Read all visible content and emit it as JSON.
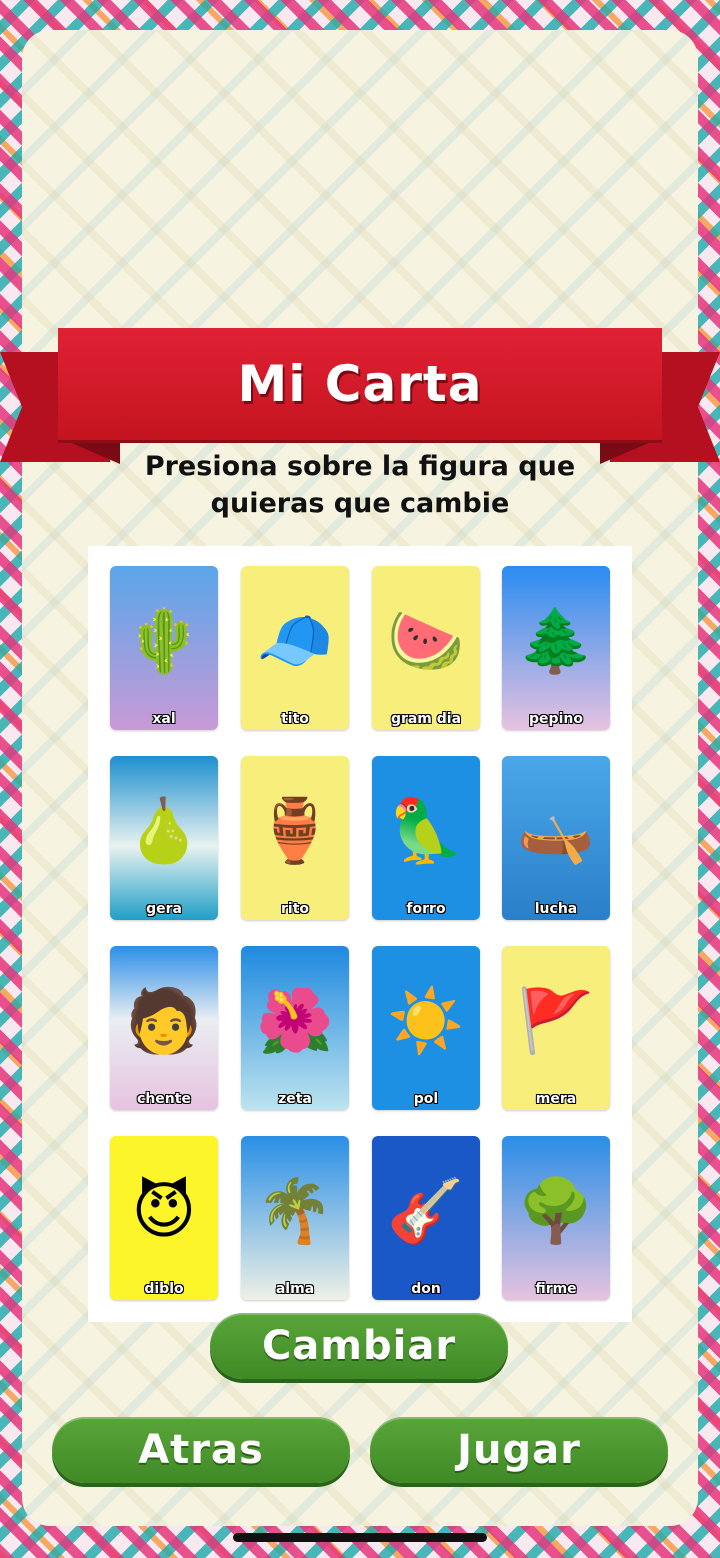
{
  "header": {
    "title": "Mi Carta"
  },
  "instructions": {
    "line1": "Presiona sobre la figura que",
    "line2": "quieras que cambie"
  },
  "cards": [
    {
      "label": "xal",
      "icon": "cactus-icon",
      "glyph": "🌵",
      "bg": "linear-gradient(#5aa6ea,#c89ad6)"
    },
    {
      "label": "tito",
      "icon": "winter-hat-icon",
      "glyph": "🧢",
      "bg": "#f8ee7c"
    },
    {
      "label": "gram dia",
      "icon": "watermelon-icon",
      "glyph": "🍉",
      "bg": "#f8ee7c"
    },
    {
      "label": "pepino",
      "icon": "pine-tree-icon",
      "glyph": "🌲",
      "bg": "linear-gradient(#2a8cf0,#e7c2e0)"
    },
    {
      "label": "gera",
      "icon": "pear-icon",
      "glyph": "🍐",
      "bg": "linear-gradient(#1e8fcf,#e8f2f0 55%,#1f9fc7)"
    },
    {
      "label": "rito",
      "icon": "clay-jug-icon",
      "glyph": "🏺",
      "bg": "#f8ee7c"
    },
    {
      "label": "forro",
      "icon": "parrot-icon",
      "glyph": "🦜",
      "bg": "#1e90e4"
    },
    {
      "label": "lucha",
      "icon": "boat-girl-icon",
      "glyph": "🛶",
      "bg": "linear-gradient(#4aa7e9,#2a7fc9)"
    },
    {
      "label": "chente",
      "icon": "charro-man-icon",
      "glyph": "🧑",
      "bg": "linear-gradient(#2c8ee8,#e9eef2 45%,#e7c2e0)"
    },
    {
      "label": "zeta",
      "icon": "flower-pot-icon",
      "glyph": "🌺",
      "bg": "linear-gradient(#1f89df,#bde3ee)"
    },
    {
      "label": "pol",
      "icon": "sun-icon",
      "glyph": "☀️",
      "bg": "#1e90e4"
    },
    {
      "label": "mera",
      "icon": "flag-icon",
      "glyph": "🚩",
      "bg": "#f8ee7c"
    },
    {
      "label": "diblo",
      "icon": "devil-icon",
      "glyph": "😈",
      "bg": "#fbf52a"
    },
    {
      "label": "alma",
      "icon": "palm-tree-icon",
      "glyph": "🌴",
      "bg": "linear-gradient(#2a8fe6,#eef1e6)"
    },
    {
      "label": "don",
      "icon": "mandolin-icon",
      "glyph": "🎸",
      "bg": "#1a58c8"
    },
    {
      "label": "firme",
      "icon": "tree-icon",
      "glyph": "🌳",
      "bg": "linear-gradient(#2a8ee6,#e6c3e0)"
    }
  ],
  "buttons": {
    "change": "Cambiar",
    "back": "Atras",
    "play": "Jugar"
  }
}
